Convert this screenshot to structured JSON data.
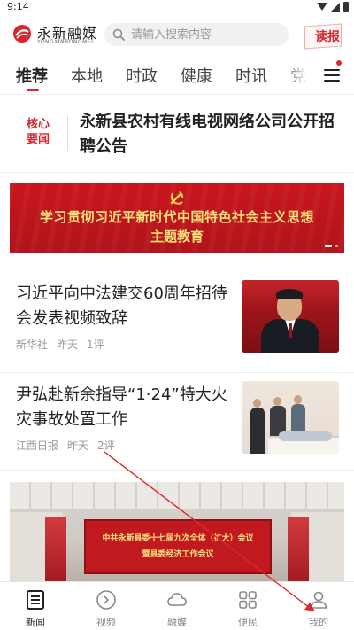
{
  "status_bar": {
    "time": "9:14"
  },
  "header": {
    "logo_name": "永新融媒",
    "logo_pinyin": "YONGXINRONGMEI",
    "search_placeholder": "请输入搜索内容",
    "dubao_label": "读报"
  },
  "tabs": [
    {
      "label": "推荐",
      "active": true
    },
    {
      "label": "本地",
      "active": false
    },
    {
      "label": "时政",
      "active": false
    },
    {
      "label": "健康",
      "active": false
    },
    {
      "label": "时讯",
      "active": false
    },
    {
      "label": "党",
      "active": false
    }
  ],
  "key_news": {
    "label": "核心要闻",
    "title": "永新县农村有线电视网络公司公开招聘公告"
  },
  "banner": {
    "line1": "学习贯彻习近平新时代中国特色社会主义思想",
    "line2": "主题教育"
  },
  "news": [
    {
      "title": "习近平向中法建交60周年招待会发表视频致辞",
      "source": "新华社",
      "time": "昨天",
      "comments": "1评"
    },
    {
      "title": "尹弘赴新余指导“1·24”特大火灾事故处置工作",
      "source": "江西日报",
      "time": "昨天",
      "comments": "2评"
    }
  ],
  "big_image": {
    "screen_line1": "中共永新县委十七届九次全体（扩大）会议",
    "screen_line2": "暨县委经济工作会议"
  },
  "bottom_nav": [
    {
      "label": "新闻",
      "icon": "news-icon",
      "active": true
    },
    {
      "label": "视频",
      "icon": "video-play-icon",
      "active": false
    },
    {
      "label": "融媒",
      "icon": "cloud-icon",
      "active": false
    },
    {
      "label": "便民",
      "icon": "grid-icon",
      "active": false
    },
    {
      "label": "我的",
      "icon": "user-icon",
      "active": false
    }
  ],
  "colors": {
    "accent": "#d6262e",
    "banner_text": "#ffe27a",
    "annotation_arrow": "#e0262b"
  }
}
